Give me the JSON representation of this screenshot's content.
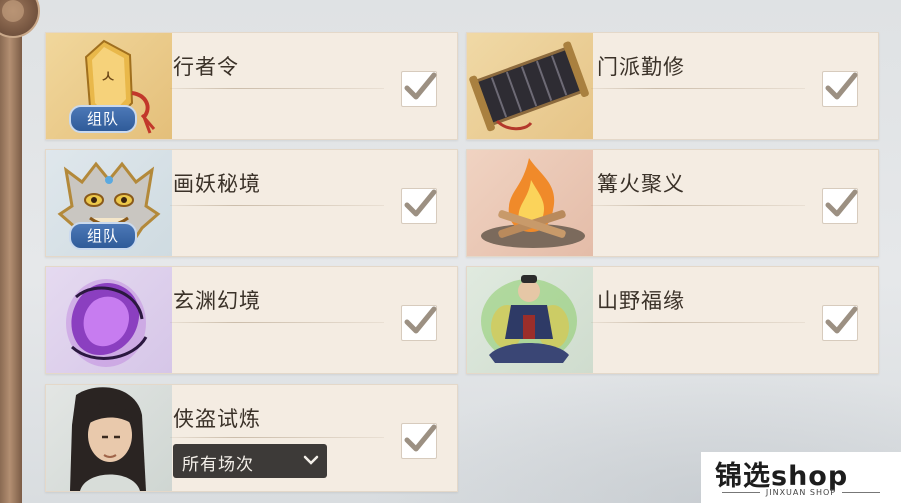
{
  "tasks": [
    {
      "title": "行者令",
      "badge": "组队",
      "checked": true,
      "icon": "golden-token-icon"
    },
    {
      "title": "门派勤修",
      "checked": true,
      "icon": "scroll-icon"
    },
    {
      "title": "画妖秘境",
      "badge": "组队",
      "checked": true,
      "icon": "demon-mask-icon"
    },
    {
      "title": "篝火聚义",
      "checked": true,
      "icon": "bonfire-icon"
    },
    {
      "title": "玄渊幻境",
      "checked": true,
      "icon": "purple-crystal-icon"
    },
    {
      "title": "山野福缘",
      "checked": true,
      "icon": "meditating-monk-icon"
    },
    {
      "title": "侠盗试炼",
      "checked": true,
      "icon": "swordsman-portrait-icon",
      "dropdown": {
        "selected": "所有场次"
      }
    }
  ],
  "watermark": {
    "brand": "锦选shop",
    "sub": "JINXUAN SHOP"
  },
  "colors": {
    "card_bg": "#f4ece2",
    "badge": "#2f5b99",
    "check": "#9c9082",
    "dropdown_bg": "#3d3a38"
  }
}
